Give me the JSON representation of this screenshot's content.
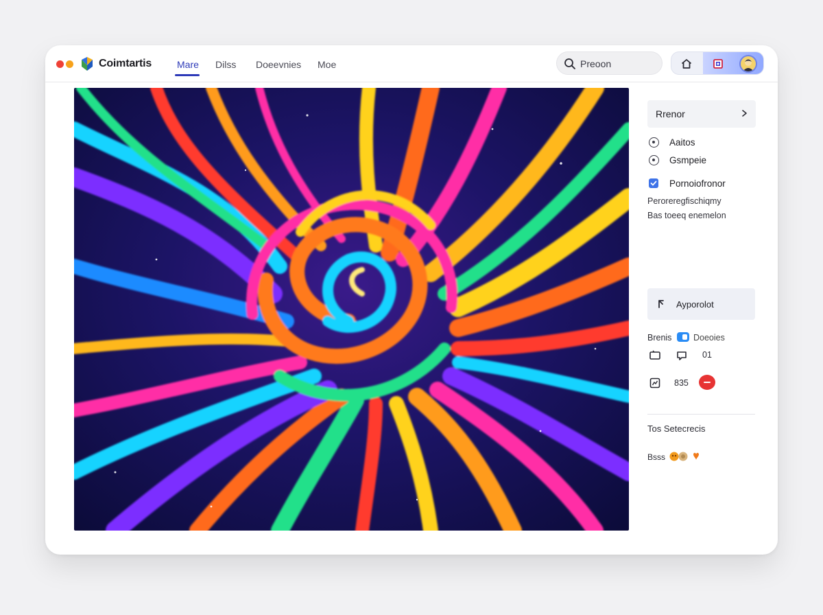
{
  "window": {
    "brand": "Coimtartis",
    "nav": [
      "Mare",
      "Dilss",
      "Doeevnies",
      "Moe"
    ],
    "active_nav": "Mare",
    "search": {
      "placeholder": "Preoon"
    },
    "toolbar": {
      "icons": [
        "home-icon",
        "photo-icon",
        "avatar"
      ]
    }
  },
  "sidebar": {
    "panel_title": "Rrenor",
    "options": [
      {
        "label": "Aaitos",
        "selected": true
      },
      {
        "label": "Gsmpeie",
        "selected": false
      }
    ],
    "checkbox_label": "Pornoiofronor",
    "checkbox_checked": true,
    "description_lines": [
      "Peroreregfischiqmy",
      "Bas toeeq enemelon"
    ],
    "action_button": "Ayporolot",
    "stats": {
      "label": "Brenis",
      "toggle_label": "Doeoies",
      "comment_count": "01",
      "views": "835"
    },
    "section_title": "Tos Setecrecis",
    "reactions_label": "Bsss"
  },
  "colors": {
    "accent": "#2d3ab8",
    "checkbox": "#3e73e8",
    "toggle": "#2a8cf5",
    "record": "#e73434"
  }
}
